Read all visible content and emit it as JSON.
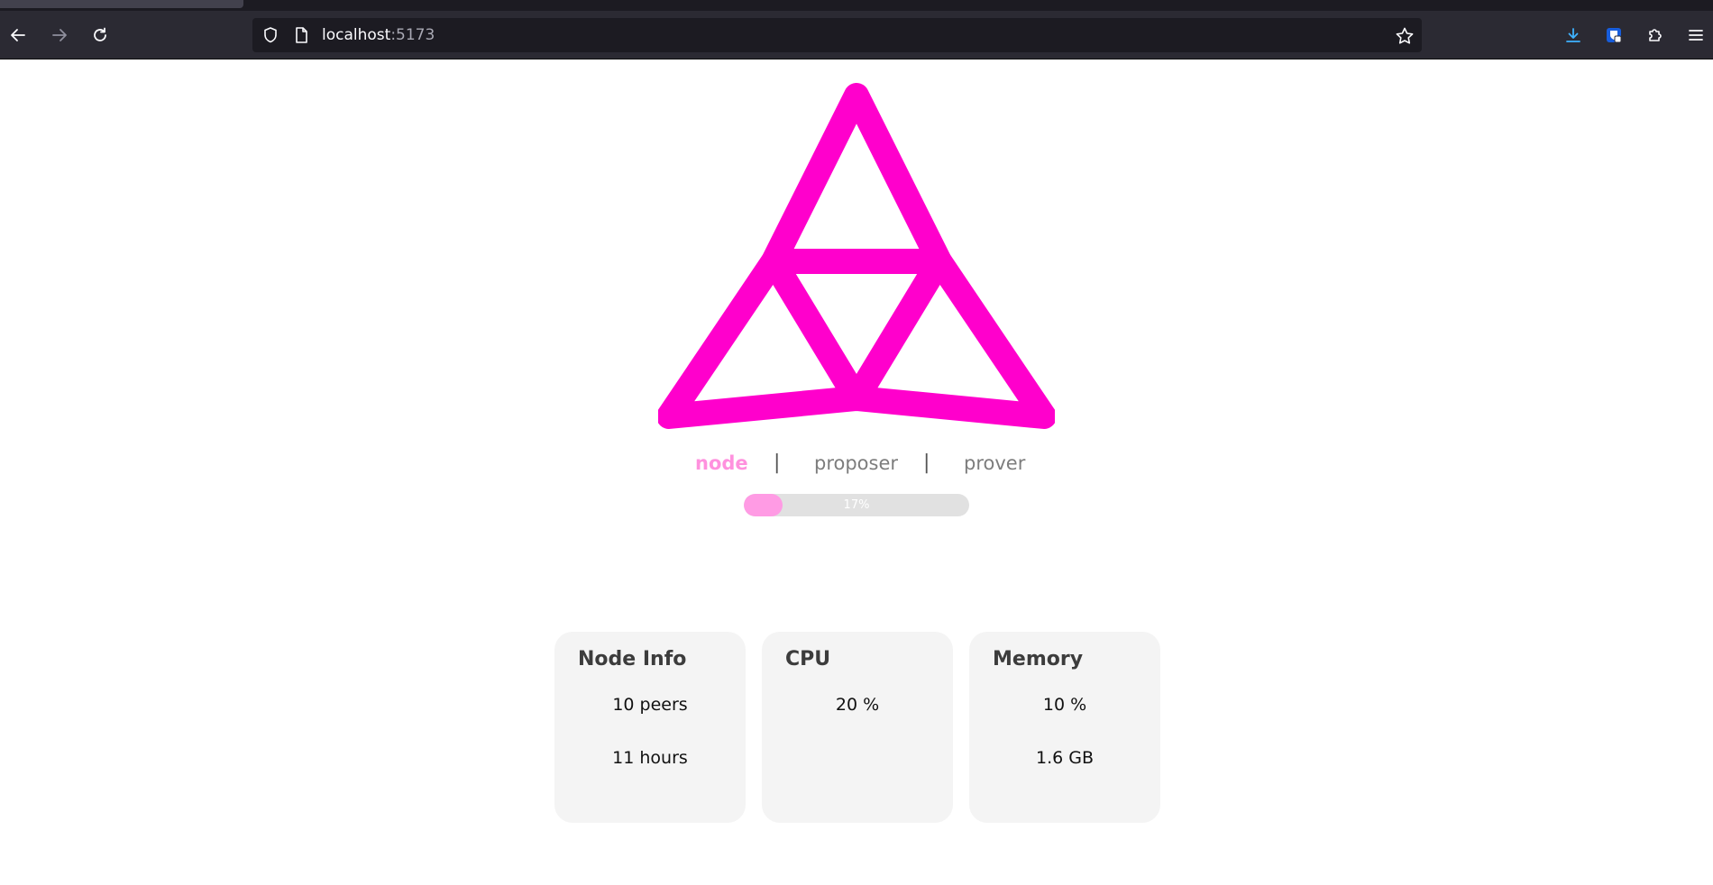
{
  "browser": {
    "url_host": "localhost",
    "url_port": ":5173"
  },
  "brand": {
    "accent": "#ff00cc",
    "accent_light": "#ff91de"
  },
  "nav": {
    "items": [
      {
        "label": "node",
        "active": true
      },
      {
        "label": "proposer",
        "active": false
      },
      {
        "label": "prover",
        "active": false
      }
    ],
    "separator": "|"
  },
  "progress": {
    "percent": 17,
    "label": "17%"
  },
  "cards": [
    {
      "title": "Node Info",
      "values": [
        "10 peers",
        "11 hours"
      ]
    },
    {
      "title": "CPU",
      "values": [
        "20 %"
      ]
    },
    {
      "title": "Memory",
      "values": [
        "10 %",
        "1.6 GB"
      ]
    }
  ]
}
